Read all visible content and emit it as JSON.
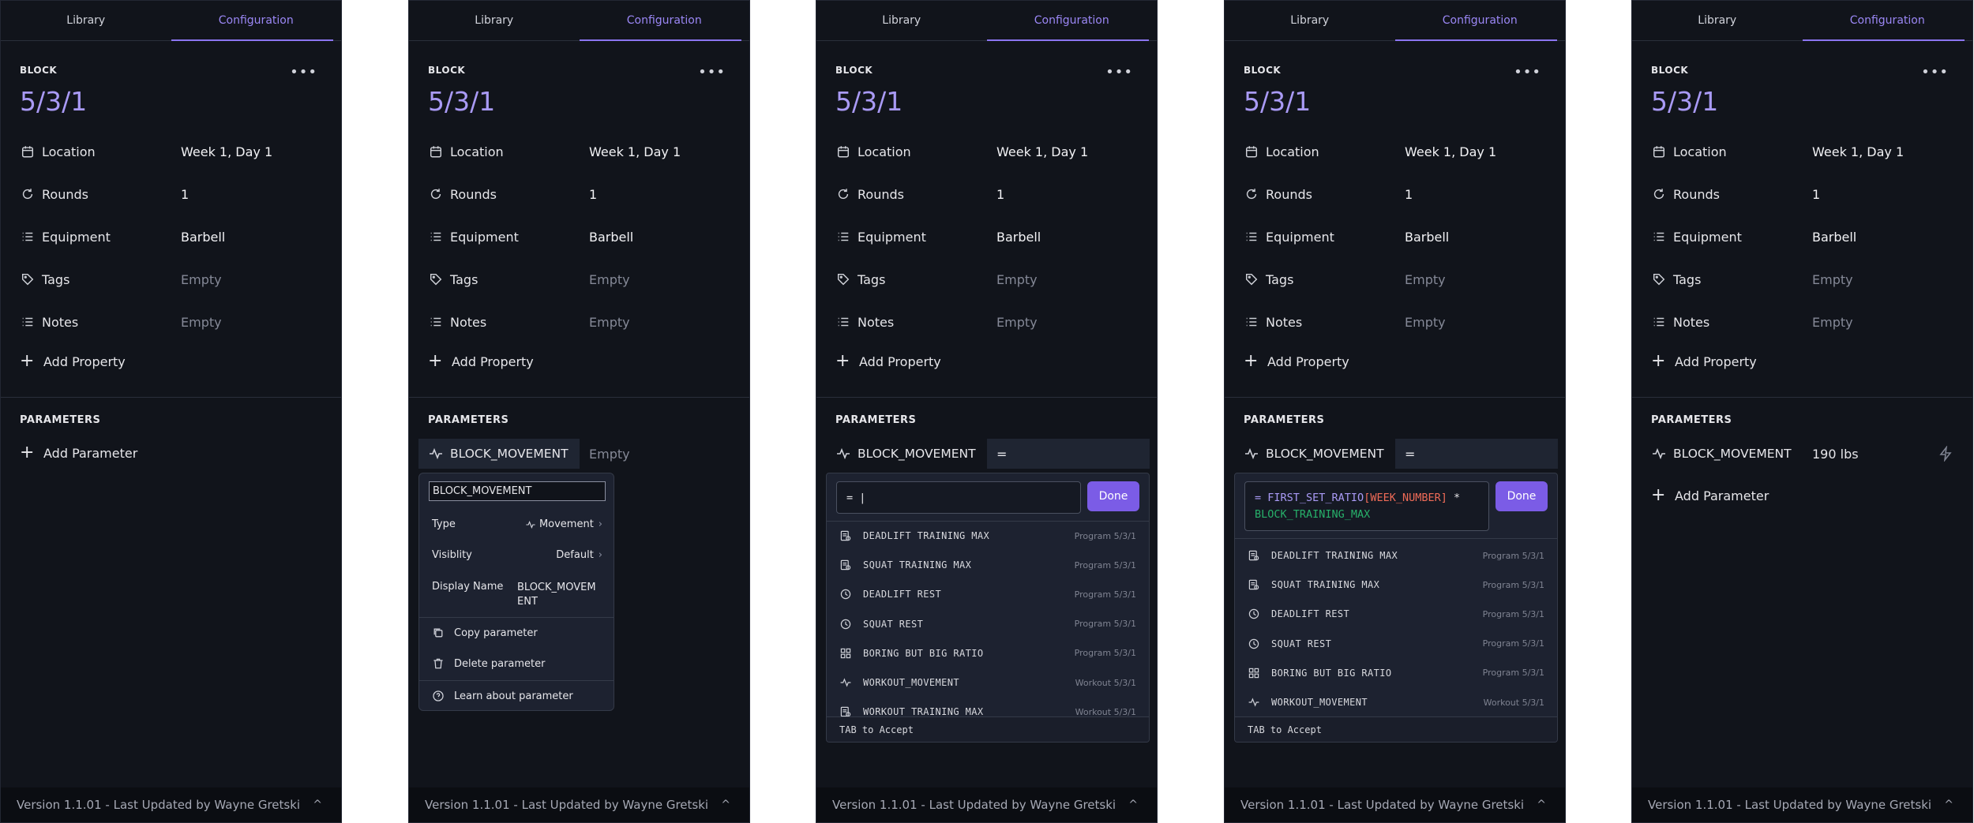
{
  "tabs": {
    "library": "Library",
    "configuration": "Configuration"
  },
  "block": {
    "label": "BLOCK",
    "more": "•••",
    "title": "5/3/1"
  },
  "properties": {
    "location": {
      "name": "Location",
      "value": "Week 1, Day 1"
    },
    "rounds": {
      "name": "Rounds",
      "value": "1"
    },
    "equipment": {
      "name": "Equipment",
      "value": "Barbell"
    },
    "tags": {
      "name": "Tags",
      "value": "Empty"
    },
    "notes": {
      "name": "Notes",
      "value": "Empty"
    },
    "add": "Add Property"
  },
  "parameters": {
    "label": "PARAMETERS",
    "add": "Add Parameter",
    "name": "BLOCK_MOVEMENT",
    "empty_value": "Empty",
    "eq_value": "=",
    "final_value": "190 lbs"
  },
  "popover": {
    "input_value": "BLOCK_MOVEMENT",
    "type_label": "Type",
    "type_value": "Movement",
    "visibility_label": "Visiblity",
    "visibility_value": "Default",
    "display_label": "Display Name",
    "display_value_1": "BLOCK_MOVEM",
    "display_value_2": "ENT",
    "copy": "Copy parameter",
    "delete": "Delete parameter",
    "learn": "Learn about parameter"
  },
  "autocomplete": {
    "input_prefix": "= |",
    "done": "Done",
    "expr_eq": "= ",
    "expr_fn": "FIRST_SET_RATIO",
    "expr_arg": "[WEEK_NUMBER]",
    "expr_op": " *",
    "expr_tail": "BLOCK_TRAINING_MAX",
    "items": [
      {
        "label": "DEADLIFT TRAINING MAX",
        "source": "Program 5/3/1",
        "icon": "table-icon"
      },
      {
        "label": "SQUAT TRAINING MAX",
        "source": "Program 5/3/1",
        "icon": "table-icon"
      },
      {
        "label": "DEADLIFT REST",
        "source": "Program 5/3/1",
        "icon": "clock-icon"
      },
      {
        "label": "SQUAT REST",
        "source": "Program 5/3/1",
        "icon": "clock-icon"
      },
      {
        "label": "BORING BUT BIG RATIO",
        "source": "Program 5/3/1",
        "icon": "grid-icon"
      },
      {
        "label": "WORKOUT_MOVEMENT",
        "source": "Workout 5/3/1",
        "icon": "activity-icon"
      },
      {
        "label": "WORKOUT TRAINING MAX",
        "source": "Workout 5/3/1",
        "icon": "table-icon"
      }
    ],
    "footer": "TAB to Accept"
  },
  "footer": {
    "text": "Version 1.1.01 - Last Updated by Wayne Gretski",
    "chevron": "^"
  },
  "colors": {
    "accent": "#9b87f5",
    "button": "#7b5ce6",
    "panel_bg": "#11141b"
  }
}
